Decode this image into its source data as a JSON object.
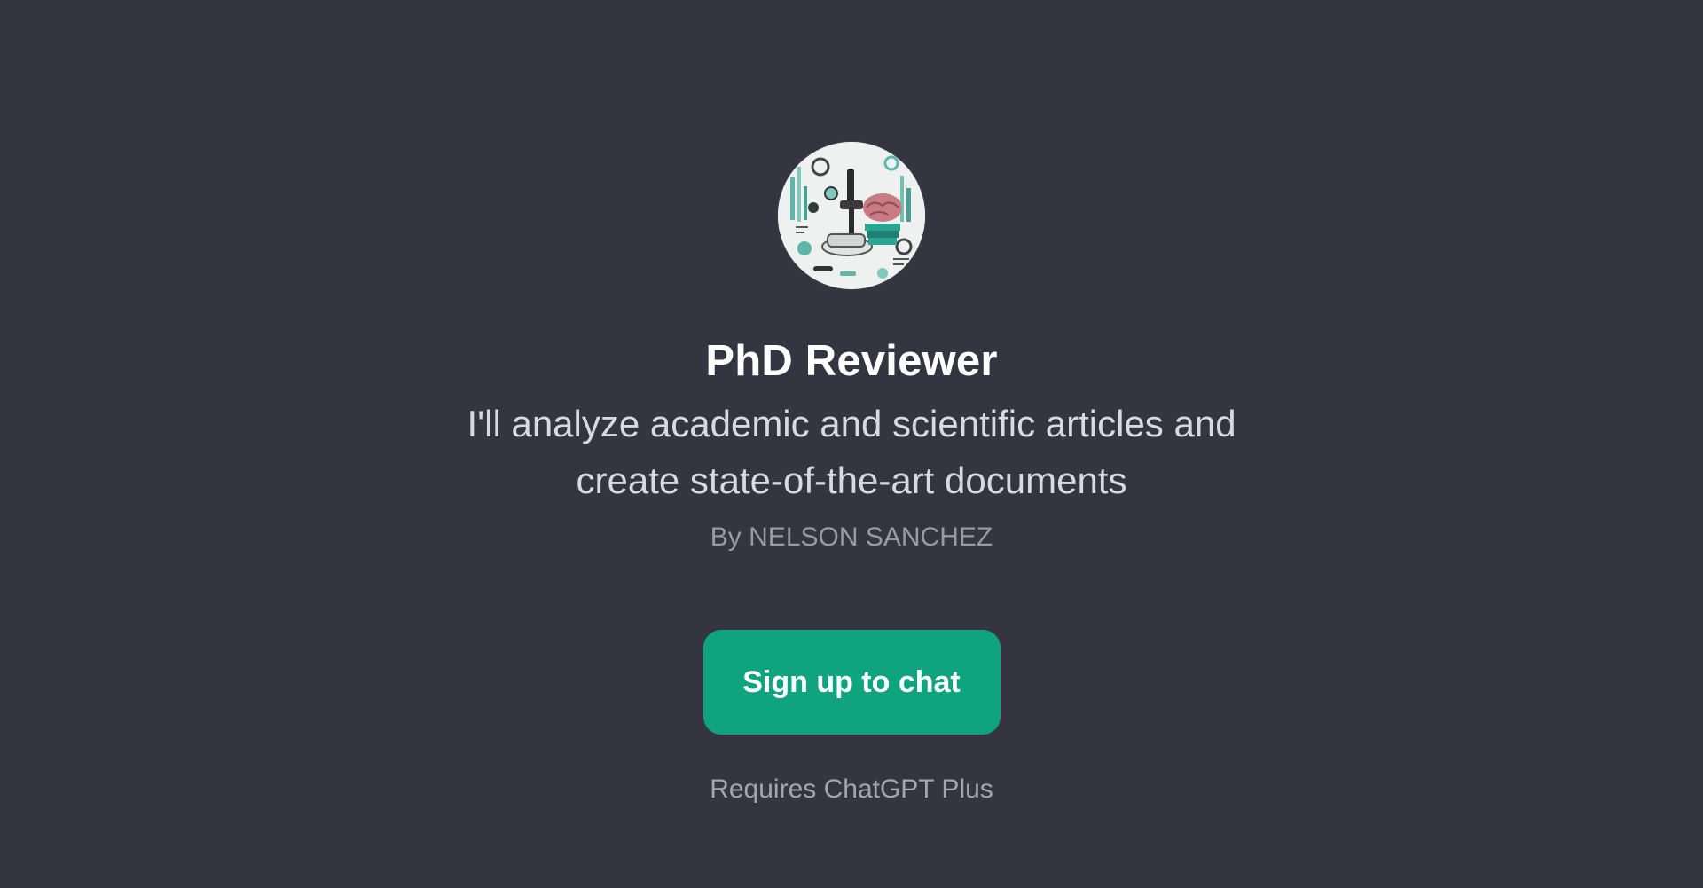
{
  "gpt": {
    "avatar_icon": "science-lab-illustration-icon",
    "title": "PhD Reviewer",
    "description": "I'll analyze academic and scientific articles and create state-of-the-art documents",
    "author": "By NELSON SANCHEZ"
  },
  "actions": {
    "signup_label": "Sign up to chat",
    "requirement": "Requires ChatGPT Plus"
  },
  "colors": {
    "background": "#343541",
    "accent": "#10a37f",
    "title": "#ffffff",
    "description": "#d9d9e3",
    "muted": "#9a9aa6"
  }
}
